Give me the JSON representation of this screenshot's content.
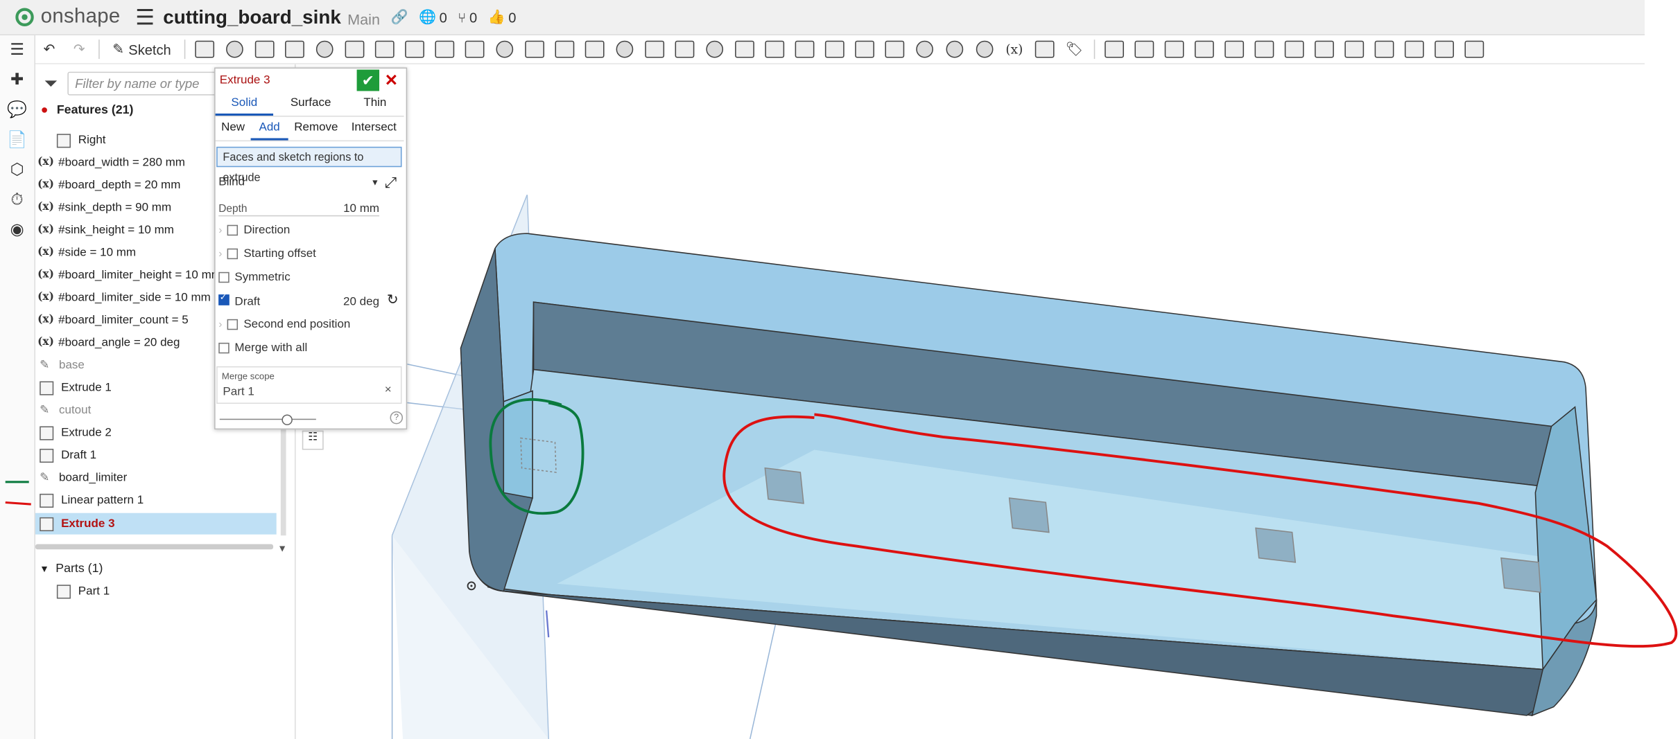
{
  "app": {
    "brand": "onshape",
    "doc_title": "cutting_board_sink",
    "branch": "Main",
    "versions_count": "0",
    "branch_count": "0",
    "likes_count": "0"
  },
  "toolbar": {
    "sketch_label": "Sketch"
  },
  "filter": {
    "placeholder": "Filter by name or type"
  },
  "features": {
    "header": "Features (21)",
    "items": [
      {
        "label": "Right",
        "kind": "plane"
      },
      {
        "label": "#board_width = 280 mm",
        "kind": "variable"
      },
      {
        "label": "#board_depth = 20 mm",
        "kind": "variable"
      },
      {
        "label": "#sink_depth = 90 mm",
        "kind": "variable"
      },
      {
        "label": "#sink_height = 10 mm",
        "kind": "variable"
      },
      {
        "label": "#side = 10 mm",
        "kind": "variable"
      },
      {
        "label": "#board_limiter_height = 10 mm",
        "kind": "variable"
      },
      {
        "label": "#board_limiter_side = 10 mm",
        "kind": "variable"
      },
      {
        "label": "#board_limiter_count = 5",
        "kind": "variable"
      },
      {
        "label": "#board_angle = 20 deg",
        "kind": "variable"
      },
      {
        "label": "base",
        "kind": "sketch"
      },
      {
        "label": "Extrude 1",
        "kind": "extrude"
      },
      {
        "label": "cutout",
        "kind": "sketch"
      },
      {
        "label": "Extrude 2",
        "kind": "extrude"
      },
      {
        "label": "Draft 1",
        "kind": "draft"
      },
      {
        "label": "board_limiter",
        "kind": "sketch"
      },
      {
        "label": "Linear pattern 1",
        "kind": "pattern"
      },
      {
        "label": "Extrude 3",
        "kind": "extrude"
      }
    ],
    "parts_header": "Parts (1)",
    "part": "Part 1"
  },
  "extrude": {
    "title": "Extrude 3",
    "type_tabs": [
      "Solid",
      "Surface",
      "Thin"
    ],
    "op_tabs": [
      "New",
      "Add",
      "Remove",
      "Intersect"
    ],
    "selection_hint": "Faces and sketch regions to extrude",
    "end_type": "Blind",
    "depth_label": "Depth",
    "depth_value": "10 mm",
    "direction": "Direction",
    "starting_offset": "Starting offset",
    "symmetric": "Symmetric",
    "draft": "Draft",
    "draft_value": "20 deg",
    "second_end": "Second end position",
    "merge_all": "Merge with all",
    "merge_scope_label": "Merge scope",
    "merge_scope_value": "Part 1",
    "help": "?"
  },
  "colors": {
    "accent": "#1a58b8",
    "ok": "#1e9c3a",
    "cancel": "#cc0000",
    "selected_row": "#bfe0f5",
    "annotation_red": "#dd1111",
    "annotation_green": "#0a7a3e"
  }
}
